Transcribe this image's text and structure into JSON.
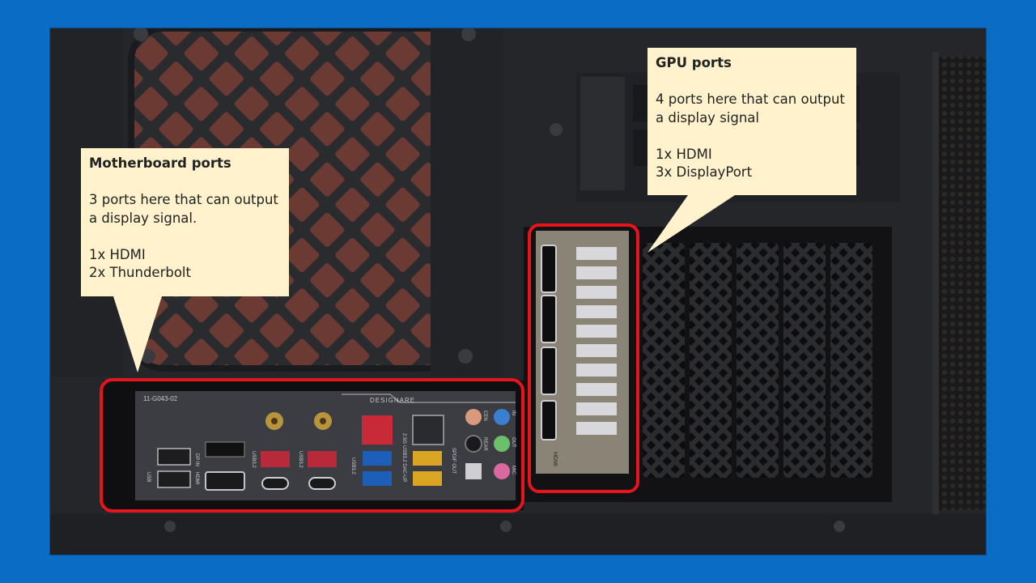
{
  "motherboard": {
    "title": "Motherboard ports",
    "summary": "3 ports here that can output a display signal.",
    "items": [
      "1x HDMI",
      "2x Thunderbolt"
    ]
  },
  "gpu": {
    "title": "GPU ports",
    "summary": "4 ports here that can output a display signal",
    "items": [
      "1x HDMI",
      "3x DisplayPort"
    ]
  },
  "board_labels": {
    "model": "11-G043-02",
    "brand": "DESIGNARE",
    "usb32_a": "USB3.2",
    "usb32_b": "USB3.2",
    "usb32_c": "USB3.2",
    "usb32_dac": "USB3.2 DAC-UP",
    "hdmi": "HDMI",
    "dp_in": "DP IN",
    "qflash": "USB",
    "lan": "2.5G",
    "spdif": "SPDIF OUT",
    "rear": "REAR",
    "cen": "CEN",
    "line_in": "IN",
    "line_out": "OUT",
    "mic": "MIC"
  },
  "gpu_label": "HDMI",
  "colors": {
    "background": "#0a6cc4",
    "callout_fill": "#fff2cc",
    "highlight": "#e8141c",
    "case": "#1c1d21"
  }
}
